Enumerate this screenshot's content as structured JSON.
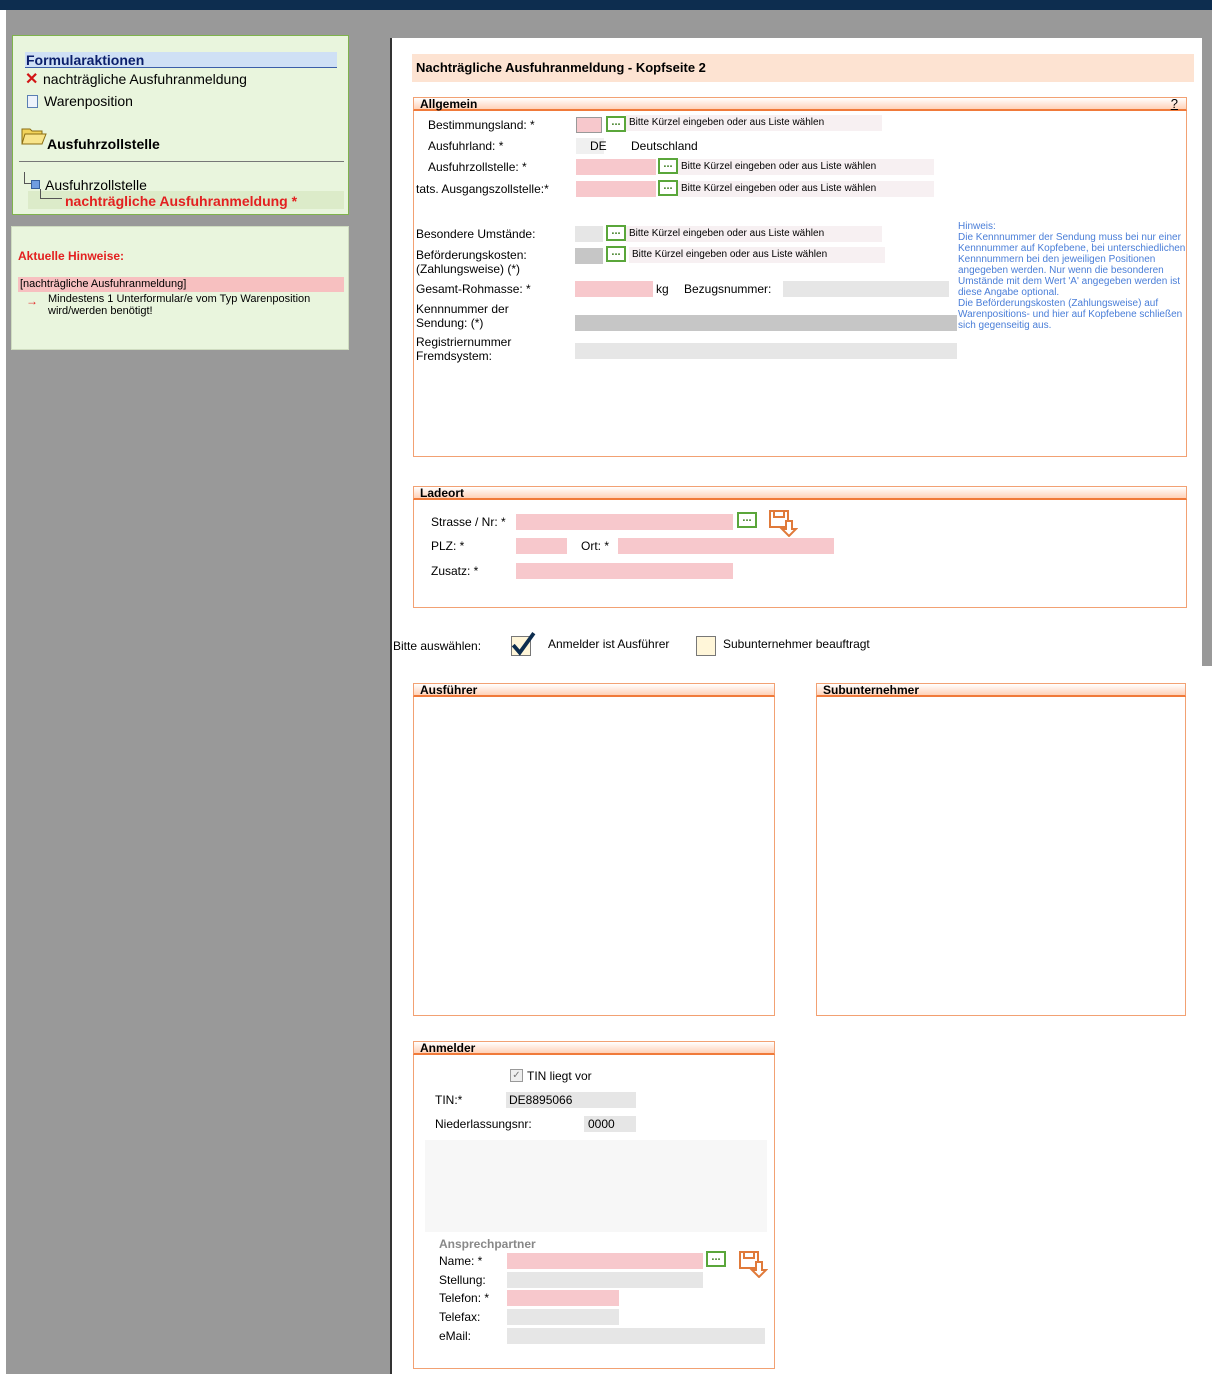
{
  "nav": {
    "title": "Formularaktionen",
    "items": [
      {
        "label": "nachträgliche Ausfuhranmeldung",
        "icon": "close-icon"
      },
      {
        "label": "Warenposition",
        "icon": "document-icon"
      }
    ],
    "section": "Ausfuhrzollstelle",
    "tree": {
      "root": "Ausfuhrzollstelle",
      "selected": "nachträgliche Ausfuhranmeldung *"
    }
  },
  "hints": {
    "title": "Aktuelle Hinweise:",
    "context": "[nachträgliche Ausfuhranmeldung]",
    "message": "Mindestens 1 Unterformular/e vom Typ Warenposition wird/werden benötigt!"
  },
  "page": {
    "title": "Nachträgliche Ausfuhranmeldung - Kopfseite 2"
  },
  "allgemein": {
    "legend": "Allgemein",
    "help": "?",
    "picker_hint": "Bitte Kürzel eingeben oder aus Liste wählen",
    "picker_label": "...",
    "bestimmungsland": {
      "label": "Bestimmungsland: *",
      "value": ""
    },
    "ausfuhrland": {
      "label": "Ausfuhrland: *",
      "code": "DE",
      "name": "Deutschland"
    },
    "ausfuhrzollstelle": {
      "label": "Ausfuhrzollstelle: *",
      "value": ""
    },
    "ausgangszollstelle": {
      "label": "tats. Ausgangszollstelle:*",
      "value": ""
    },
    "umstaende": {
      "label": "Besondere Umstände:",
      "value": ""
    },
    "befoerderungskosten": {
      "label1": "Beförderungskosten:",
      "label2": "(Zahlungsweise) (*)",
      "value": ""
    },
    "rohmasse": {
      "label": "Gesamt-Rohmasse: *",
      "unit": "kg",
      "value": ""
    },
    "bezugsnummer": {
      "label": "Bezugsnummer:",
      "value": ""
    },
    "kennnummer": {
      "label1": "Kennnummer der",
      "label2": "Sendung: (*)",
      "value": ""
    },
    "registriernummer": {
      "label1": "Registriernummer",
      "label2": "Fremdsystem:",
      "value": ""
    },
    "note": "Hinweis:\nDie Kennnummer der Sendung muss bei nur einer Kennnummer auf Kopfebene, bei unterschiedlichen Kennnummern bei den jeweiligen Positionen angegeben werden. Nur wenn die besonderen Umstände mit dem Wert 'A' angegeben werden ist diese Angabe optional.\nDie Beförderungskosten (Zahlungsweise) auf Warenpositions- und hier auf Kopfebene schließen sich gegenseitig aus."
  },
  "ladeort": {
    "legend": "Ladeort",
    "strasse": {
      "label": "Strasse / Nr: *",
      "value": ""
    },
    "plz": {
      "label": "PLZ: *",
      "value": ""
    },
    "ort": {
      "label": "Ort: *",
      "value": ""
    },
    "zusatz": {
      "label": "Zusatz: *",
      "value": ""
    }
  },
  "auswahl": {
    "label": "Bitte auswählen:",
    "option1": {
      "label": "Anmelder ist Ausführer",
      "checked": true
    },
    "option2": {
      "label": "Subunternehmer beauftragt",
      "checked": false
    }
  },
  "ausfuehrer": {
    "legend": "Ausführer"
  },
  "subunternehmer": {
    "legend": "Subunternehmer"
  },
  "anmelder": {
    "legend": "Anmelder",
    "tin_checkbox": {
      "label": "TIN liegt vor",
      "checked": true
    },
    "tin": {
      "label": "TIN:*",
      "value": "DE8895066"
    },
    "niederlassung": {
      "label": "Niederlassungsnr:",
      "value": "0000"
    },
    "ansprechpartner": {
      "title": "Ansprechpartner",
      "name": {
        "label": "Name: *",
        "value": ""
      },
      "stellung": {
        "label": "Stellung:",
        "value": ""
      },
      "telefon": {
        "label": "Telefon: *",
        "value": ""
      },
      "telefax": {
        "label": "Telefax:",
        "value": ""
      },
      "email": {
        "label": "eMail:",
        "value": ""
      }
    }
  },
  "colors": {
    "required": "#f7c8cc",
    "optional": "#e6e6e6",
    "accent": "#f2a173",
    "hint": "#4a7ed8",
    "error": "#e32020"
  }
}
